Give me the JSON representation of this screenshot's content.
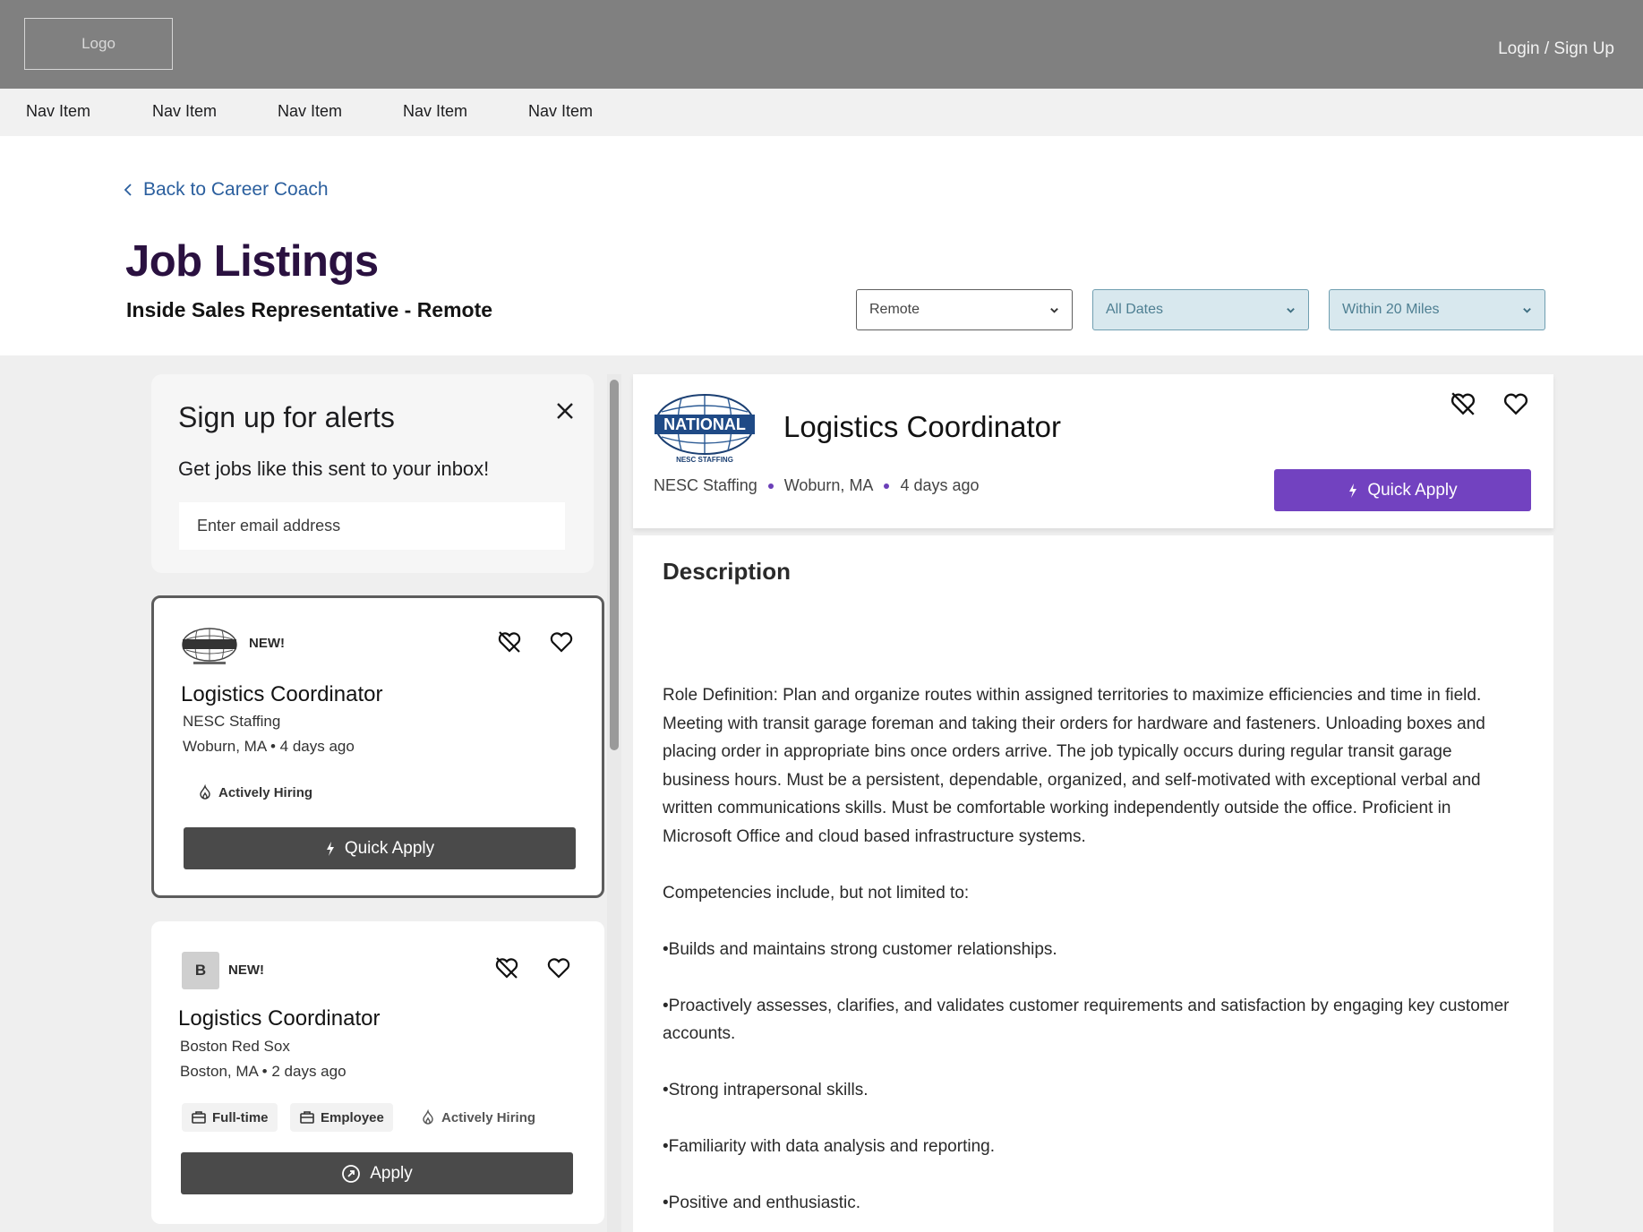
{
  "header": {
    "logo_label": "Logo",
    "login_label": "Login / Sign Up"
  },
  "nav": {
    "items": [
      "Nav Item",
      "Nav Item",
      "Nav Item",
      "Nav Item",
      "Nav Item"
    ]
  },
  "page": {
    "back_label": "Back to Career Coach",
    "title": "Job Listings",
    "subtitle": "Inside Sales Representative - Remote"
  },
  "filters": {
    "location": "Remote",
    "dates": "All Dates",
    "distance": "Within 20 Miles"
  },
  "alerts": {
    "title": "Sign up for alerts",
    "text": "Get jobs like this sent to your inbox!",
    "email_placeholder": "Enter email address"
  },
  "jobs": [
    {
      "badge": "NEW!",
      "title": "Logistics Coordinator",
      "company": "NESC Staffing",
      "location": "Woburn, MA",
      "posted": "4 days ago",
      "tags": [
        "Actively Hiring"
      ],
      "button": "Quick Apply",
      "selected": true
    },
    {
      "logo_letter": "B",
      "badge": "NEW!",
      "title": "Logistics Coordinator",
      "company": "Boston Red Sox",
      "location": "Boston, MA",
      "posted": "2 days ago",
      "tags": [
        "Full-time",
        "Employee",
        "Actively Hiring"
      ],
      "button": "Apply",
      "selected": false
    }
  ],
  "detail": {
    "logo_text": "NATIONAL",
    "logo_subtext": "NESC STAFFING",
    "title": "Logistics Coordinator",
    "company": "NESC Staffing",
    "location": "Woburn, MA",
    "posted": "4 days ago",
    "apply_label": "Quick Apply",
    "description_heading": "Description",
    "description": [
      "Role Definition: Plan and organize routes within assigned territories to maximize efficiencies and time in field. Meeting with transit garage foreman and taking their orders for hardware and fasteners. Unloading boxes and placing order in appropriate bins once orders arrive. The job typically occurs during regular transit garage business hours. Must be a persistent, dependable, organized, and self-motivated with exceptional verbal and written communications skills. Must be comfortable working independently outside the office. Proficient in Microsoft Office and cloud based infrastructure systems.",
      "Competencies include, but not limited to:",
      "•Builds and maintains strong customer relationships.",
      "•Proactively assesses, clarifies, and validates customer requirements and satisfaction by engaging key customer accounts.",
      "•Strong intrapersonal skills.",
      "•Familiarity with data analysis and reporting.",
      "•Positive and enthusiastic."
    ]
  },
  "colors": {
    "header_bg": "#808080",
    "title_color": "#2a1140",
    "link_color": "#2b5f9e",
    "accent_purple": "#7242c0",
    "dark_button": "#4a4a4a"
  }
}
